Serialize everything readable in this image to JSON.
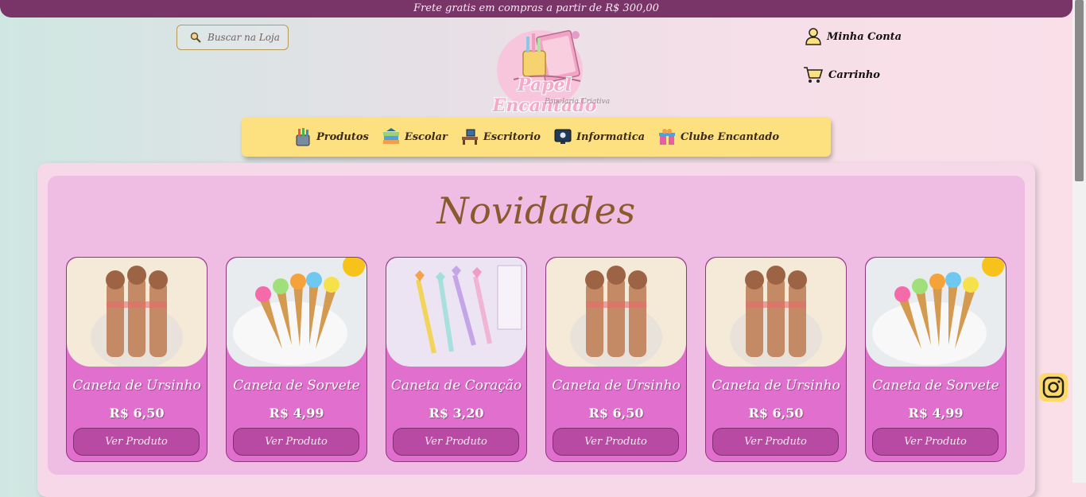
{
  "topbar": {
    "text": "Frete gratis em compras a partir de R$ 300,00"
  },
  "search": {
    "placeholder": "Buscar na Loja"
  },
  "logo": {
    "title": "Papel Encantado",
    "subtitle": "Papelaria Criativa"
  },
  "header": {
    "account_label": "Minha Conta",
    "cart_label": "Carrinho"
  },
  "nav": {
    "items": [
      {
        "label": "Produtos",
        "icon": "pencil-cup-icon"
      },
      {
        "label": "Escolar",
        "icon": "books-icon"
      },
      {
        "label": "Escritorio",
        "icon": "desk-icon"
      },
      {
        "label": "Informatica",
        "icon": "monitor-icon"
      },
      {
        "label": "Clube Encantado",
        "icon": "gift-icon"
      }
    ]
  },
  "section": {
    "title": "Novidades"
  },
  "products": [
    {
      "name": "Caneta de Ursinho",
      "price": "R$ 6,50",
      "button": "Ver Produto",
      "image": "bear-pens"
    },
    {
      "name": "Caneta de Sorvete",
      "price": "R$ 4,99",
      "button": "Ver Produto",
      "image": "icecream-pens"
    },
    {
      "name": "Caneta de Coração",
      "price": "R$ 3,20",
      "button": "Ver Produto",
      "image": "heart-pens"
    },
    {
      "name": "Caneta de Ursinho",
      "price": "R$ 6,50",
      "button": "Ver Produto",
      "image": "bear-pens"
    },
    {
      "name": "Caneta de Ursinho",
      "price": "R$ 6,50",
      "button": "Ver Produto",
      "image": "bear-pens"
    },
    {
      "name": "Caneta de Sorvete",
      "price": "R$ 4,99",
      "button": "Ver Produto",
      "image": "icecream-pens"
    }
  ],
  "colors": {
    "topbar": "#7a3568",
    "nav_bg": "#fde07f",
    "card_bg": "#e06fcd",
    "button_bg": "#b94aa3",
    "title": "#8a5a2e"
  }
}
